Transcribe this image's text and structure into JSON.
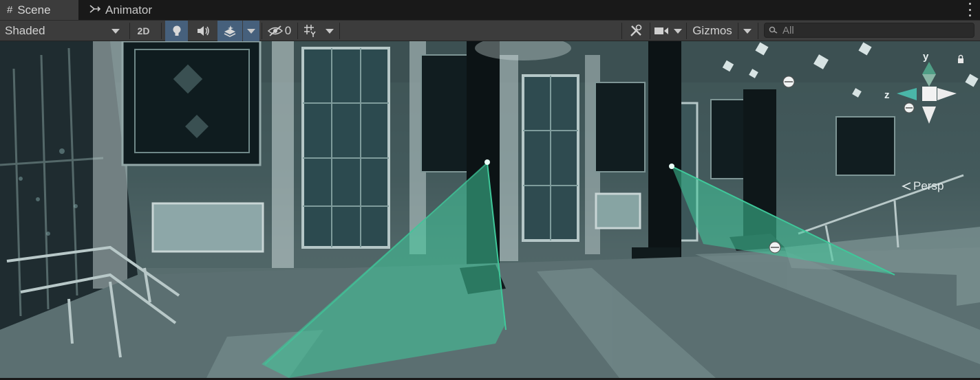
{
  "tabs": [
    {
      "label": "Scene",
      "icon": "grid-icon",
      "active": true
    },
    {
      "label": "Animator",
      "icon": "animator-icon",
      "active": false
    }
  ],
  "toolbar": {
    "draw_mode": "Shaded",
    "mode_2d_label": "2D",
    "hidden_count": "0",
    "gizmos_label": "Gizmos",
    "search_placeholder": "All"
  },
  "gizmo": {
    "axis_y": "y",
    "axis_z": "z",
    "projection": "Persp"
  },
  "colors": {
    "panel": "#3c3c3c",
    "active_toggle": "#46607c",
    "spotlight_cone": "#3fc89a"
  }
}
